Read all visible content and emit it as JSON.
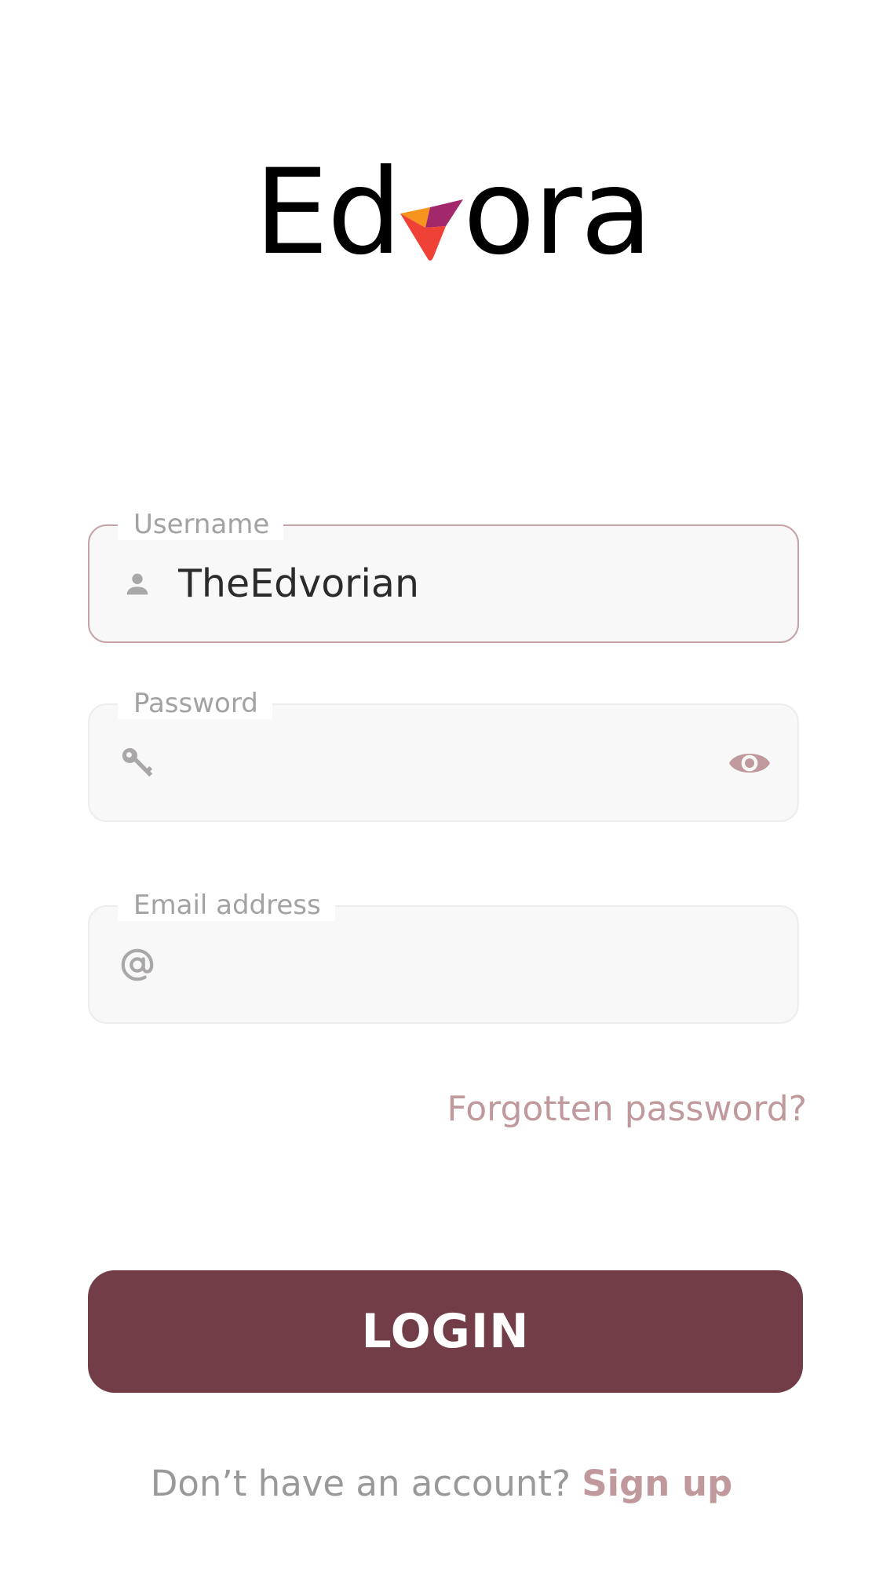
{
  "brand": {
    "logo_text_before": "Ed",
    "logo_text_after": "ora",
    "logo_mark_colors": [
      "#f7941d",
      "#ef4136",
      "#a3276b"
    ]
  },
  "form": {
    "username": {
      "label": "Username",
      "value": "TheEdvorian",
      "icon": "person-icon",
      "state": "focused"
    },
    "password": {
      "label": "Password",
      "value": "",
      "icon": "key-icon",
      "toggle_icon": "eye-icon"
    },
    "email": {
      "label": "Email address",
      "value": "",
      "icon": "at-sign-icon"
    },
    "forgot_label": "Forgotten password?",
    "login_label": "LOGIN"
  },
  "footer": {
    "prompt": "Don’t have an account?",
    "signup_label": "Sign up"
  },
  "colors": {
    "primary": "#733d47",
    "accent_text": "#c0999c",
    "field_background": "#f9f8f8",
    "focused_border": "#c4a2a5",
    "muted_text": "#a3a1a1"
  }
}
